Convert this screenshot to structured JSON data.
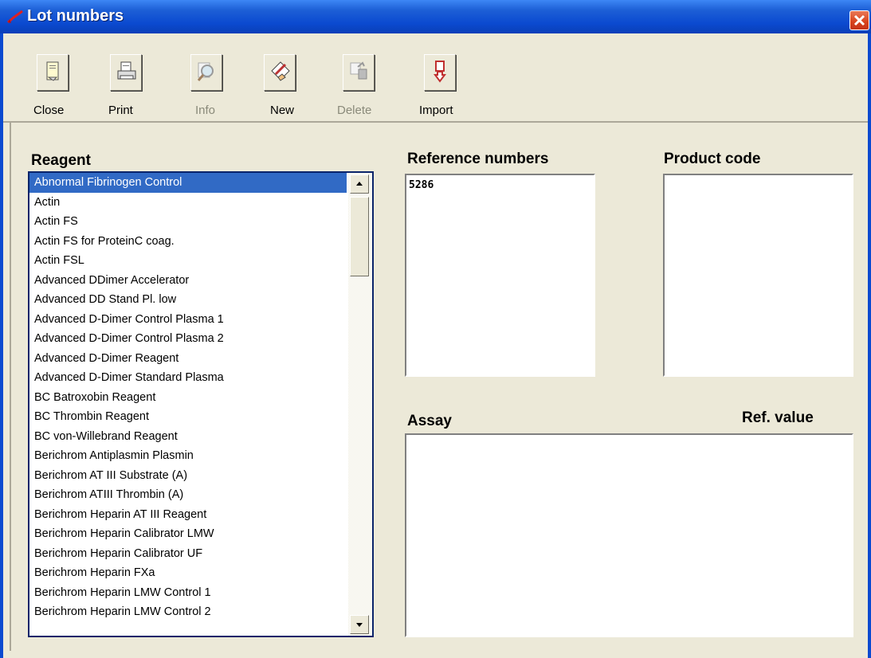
{
  "window": {
    "title": "Lot numbers"
  },
  "toolbar": {
    "buttons": [
      {
        "label": "Close",
        "icon": "note-icon",
        "enabled": true
      },
      {
        "label": "Print",
        "icon": "printer-icon",
        "enabled": true
      },
      {
        "label": "Info",
        "icon": "magnifier-icon",
        "enabled": false
      },
      {
        "label": "New",
        "icon": "pen-paper-icon",
        "enabled": true
      },
      {
        "label": "Delete",
        "icon": "trash-icon",
        "enabled": false
      },
      {
        "label": "Import",
        "icon": "import-arrow-icon",
        "enabled": true
      }
    ]
  },
  "reagent": {
    "label": "Reagent",
    "selected_index": 0,
    "items": [
      "Abnormal Fibrinogen Control",
      "Actin",
      "Actin FS",
      "Actin FS for ProteinC coag.",
      "Actin FSL",
      "Advanced  DDimer Accelerator",
      "Advanced DD Stand Pl. low",
      "Advanced D-Dimer Control Plasma 1",
      "Advanced D-Dimer Control Plasma 2",
      "Advanced D-Dimer Reagent",
      "Advanced D-Dimer Standard Plasma",
      "BC Batroxobin Reagent",
      "BC Thrombin Reagent",
      "BC von-Willebrand Reagent",
      "Berichrom Antiplasmin Plasmin",
      "Berichrom AT III Substrate (A)",
      "Berichrom ATIII Thrombin (A)",
      "Berichrom Heparin AT III Reagent",
      "Berichrom Heparin Calibrator LMW",
      "Berichrom Heparin Calibrator UF",
      "Berichrom Heparin FXa",
      "Berichrom Heparin LMW Control 1",
      "Berichrom Heparin LMW Control 2"
    ]
  },
  "reference_numbers": {
    "label": "Reference numbers",
    "values": [
      "5286"
    ]
  },
  "product_code": {
    "label": "Product code"
  },
  "assay": {
    "label": "Assay",
    "ref_value_label": "Ref. value"
  }
}
